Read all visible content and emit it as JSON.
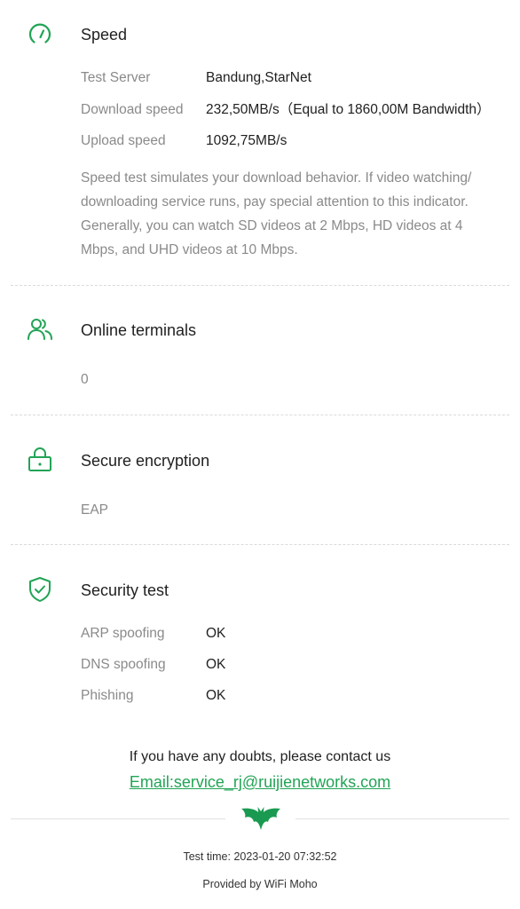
{
  "accent_color": "#22a456",
  "speed": {
    "icon": "speedometer-icon",
    "title": "Speed",
    "rows": [
      {
        "label": "Test Server",
        "value": "Bandung,StarNet"
      },
      {
        "label": "Download speed",
        "value": "232,50MB/s（Equal to 1860,00M Bandwidth）"
      },
      {
        "label": "Upload speed",
        "value": "1092,75MB/s"
      }
    ],
    "description": "Speed test simulates your download behavior. If video watching/ downloading service runs, pay special attention to this indicator. Generally, you can watch SD videos at 2 Mbps, HD videos at 4 Mbps, and UHD videos at 10 Mbps."
  },
  "terminals": {
    "icon": "users-icon",
    "title": "Online terminals",
    "value": "0"
  },
  "encryption": {
    "icon": "lock-icon",
    "title": "Secure encryption",
    "value": "EAP"
  },
  "security": {
    "icon": "shield-check-icon",
    "title": "Security test",
    "rows": [
      {
        "label": "ARP spoofing",
        "value": "OK"
      },
      {
        "label": "DNS spoofing",
        "value": "OK"
      },
      {
        "label": "Phishing",
        "value": "OK"
      }
    ]
  },
  "footer": {
    "contact_text": "If you have any doubts, please contact us",
    "email": "Email:service_rj@ruijienetworks.com",
    "logo_icon": "bat-logo-icon",
    "test_time": "Test time: 2023-01-20 07:32:52",
    "provided_by": "Provided by WiFi Moho"
  }
}
